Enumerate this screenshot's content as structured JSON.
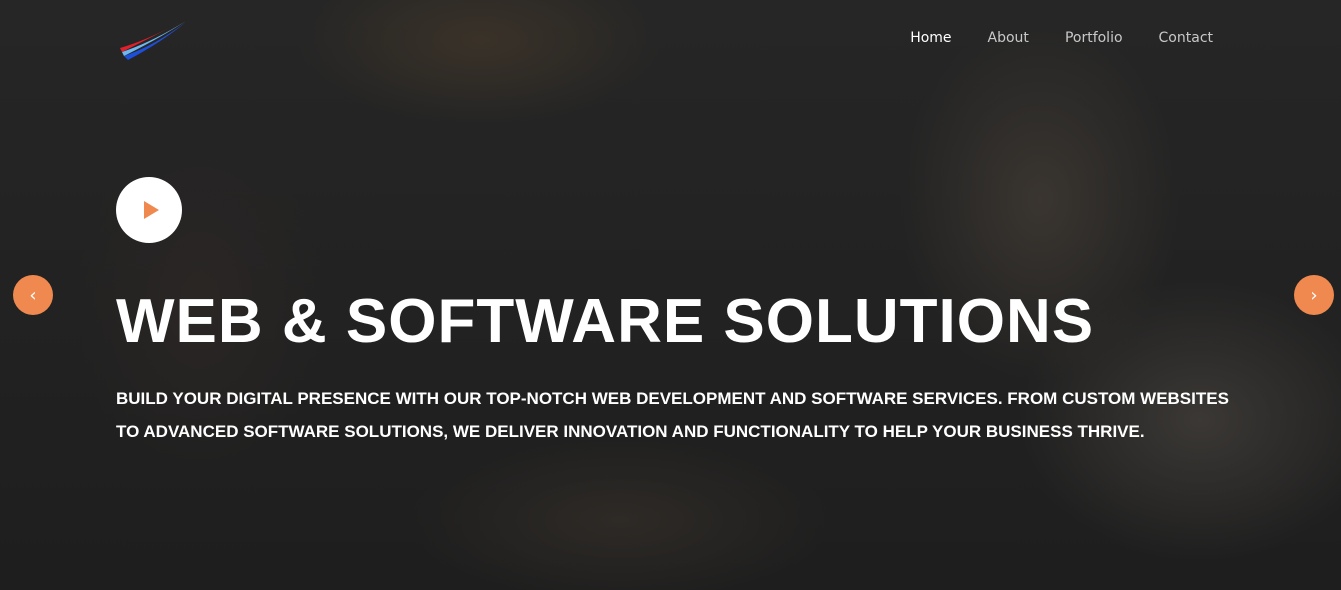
{
  "nav": {
    "items": [
      {
        "label": "Home",
        "active": true
      },
      {
        "label": "About"
      },
      {
        "label": "Portfolio"
      },
      {
        "label": "Contact"
      }
    ]
  },
  "hero": {
    "title": "WEB & SOFTWARE SOLUTIONS",
    "subtitle": "BUILD YOUR DIGITAL PRESENCE WITH OUR TOP-NOTCH WEB DEVELOPMENT AND SOFTWARE SERVICES. FROM CUSTOM WEBSITES TO ADVANCED SOFTWARE SOLUTIONS, WE DELIVER INNOVATION AND FUNCTIONALITY TO HELP YOUR BUSINESS THRIVE.",
    "play_icon": "play-icon"
  },
  "carousel": {
    "prev_icon": "chevron-left-icon",
    "next_icon": "chevron-right-icon",
    "prev_glyph": "‹",
    "next_glyph": "›"
  },
  "colors": {
    "accent": "#f0894f"
  }
}
